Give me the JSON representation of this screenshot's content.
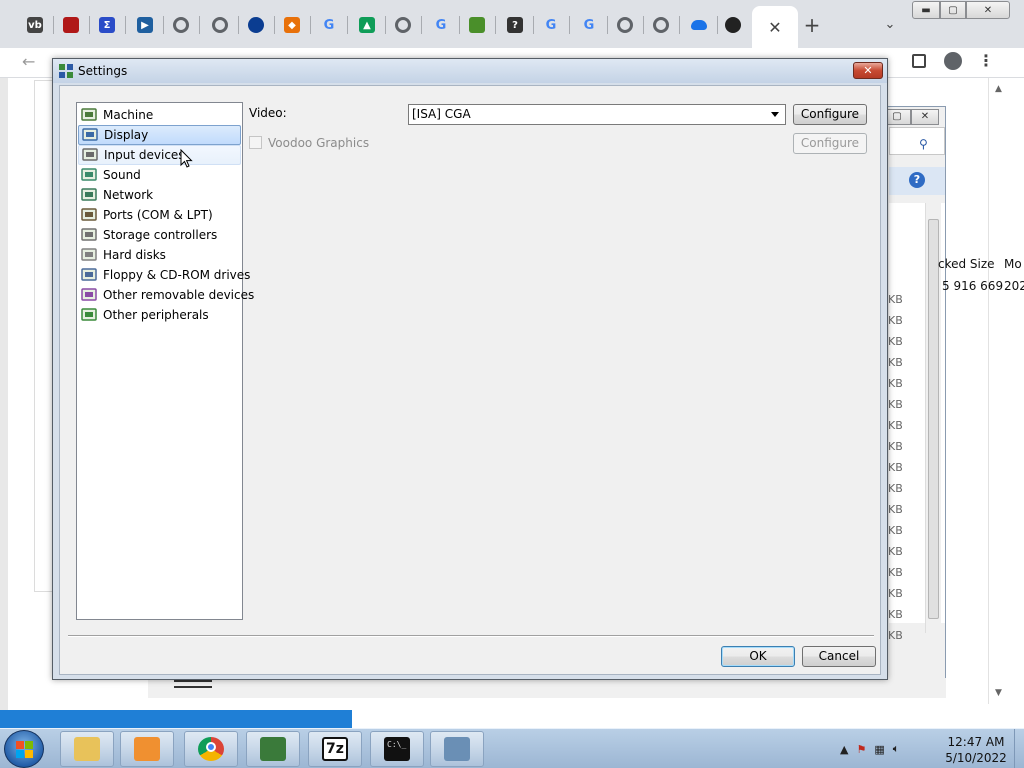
{
  "dialog": {
    "title": "Settings",
    "close_glyph": "✕",
    "categories": [
      {
        "label": "Machine",
        "icon": "machine-icon"
      },
      {
        "label": "Display",
        "icon": "display-icon"
      },
      {
        "label": "Input devices",
        "icon": "input-devices-icon"
      },
      {
        "label": "Sound",
        "icon": "sound-icon"
      },
      {
        "label": "Network",
        "icon": "network-icon"
      },
      {
        "label": "Ports (COM & LPT)",
        "icon": "ports-icon"
      },
      {
        "label": "Storage controllers",
        "icon": "storage-icon"
      },
      {
        "label": "Hard disks",
        "icon": "hard-disk-icon"
      },
      {
        "label": "Floppy & CD-ROM drives",
        "icon": "floppy-cdrom-icon"
      },
      {
        "label": "Other removable devices",
        "icon": "removable-icon"
      },
      {
        "label": "Other peripherals",
        "icon": "peripherals-icon"
      }
    ],
    "selected_category": "Display",
    "hovered_category": "Input devices",
    "display": {
      "video_label": "Video:",
      "video_value": "[ISA] CGA",
      "configure_label": "Configure",
      "voodoo_label": "Voodoo Graphics",
      "voodoo_checked": false,
      "voodoo_configure_label": "Configure"
    },
    "ok_label": "OK",
    "cancel_label": "Cancel"
  },
  "browser": {
    "new_tab_glyph": "+",
    "close_tab_glyph": "✕",
    "tab_search_glyph": "⌄",
    "window_controls": {
      "minimize": "▬",
      "maximize": "▢",
      "close": "✕"
    },
    "back_glyph": "←",
    "forward_glyph": "→",
    "menu_glyph": "⋮",
    "tabs": [
      {
        "icon": "vb-icon",
        "text": "vb",
        "color": "#444444"
      },
      {
        "icon": "red-square-icon",
        "text": "",
        "color": "#b01818"
      },
      {
        "icon": "sigma-icon",
        "text": "Σ",
        "color": "#2a4cc8"
      },
      {
        "icon": "play-icon",
        "text": "▶",
        "color": "#1f5f9f"
      },
      {
        "icon": "globe-icon",
        "text": "",
        "color": "#5f6368"
      },
      {
        "icon": "globe-icon",
        "text": "",
        "color": "#5f6368"
      },
      {
        "icon": "nasa-icon",
        "text": "",
        "color": "#0b3d91"
      },
      {
        "icon": "diamond-icon",
        "text": "◆",
        "color": "#e8710a"
      },
      {
        "icon": "google-icon",
        "text": "G",
        "color": "#4285f4"
      },
      {
        "icon": "triangle-icon",
        "text": "▲",
        "color": "#0f9d58"
      },
      {
        "icon": "globe-icon",
        "text": "",
        "color": "#5f6368"
      },
      {
        "icon": "google-icon",
        "text": "G",
        "color": "#4285f4"
      },
      {
        "icon": "chart-icon",
        "text": "",
        "color": "#4a8f2a"
      },
      {
        "icon": "question-icon",
        "text": "?",
        "color": "#333333"
      },
      {
        "icon": "google-icon",
        "text": "G",
        "color": "#4285f4"
      },
      {
        "icon": "google-icon",
        "text": "G",
        "color": "#4285f4"
      },
      {
        "icon": "globe-icon",
        "text": "",
        "color": "#5f6368"
      },
      {
        "icon": "globe-icon",
        "text": "",
        "color": "#5f6368"
      },
      {
        "icon": "cloud-icon",
        "text": "",
        "color": "#1a73e8"
      },
      {
        "icon": "github-icon",
        "text": "",
        "color": "#222222"
      }
    ]
  },
  "behind_window": {
    "col_packed_size": "cked Size",
    "col_modified": "Mo",
    "packed_value": "5 916 669",
    "modified_value": "202",
    "kb_suffix": "KB",
    "help_glyph": "?",
    "kb_rows": 17
  },
  "taskbar": {
    "time": "12:47 AM",
    "date": "5/10/2022",
    "tray_arrow": "▲",
    "seven_zip_label": "7z",
    "apps": [
      {
        "name": "explorer",
        "icon": "folder-icon",
        "color": "#e8c25a"
      },
      {
        "name": "media-player",
        "icon": "media-player-icon",
        "color": "#f09030"
      },
      {
        "name": "chrome",
        "icon": "chrome-icon",
        "color": "#db4437"
      },
      {
        "name": "86box",
        "icon": "86box-icon",
        "color": "#3a7a3a"
      },
      {
        "name": "7zip",
        "icon": "seven-zip-icon",
        "color": "#111111"
      },
      {
        "name": "cmd",
        "icon": "cmd-icon",
        "color": "#111111"
      },
      {
        "name": "notepad",
        "icon": "window-icon",
        "color": "#6a8fb5"
      }
    ]
  }
}
